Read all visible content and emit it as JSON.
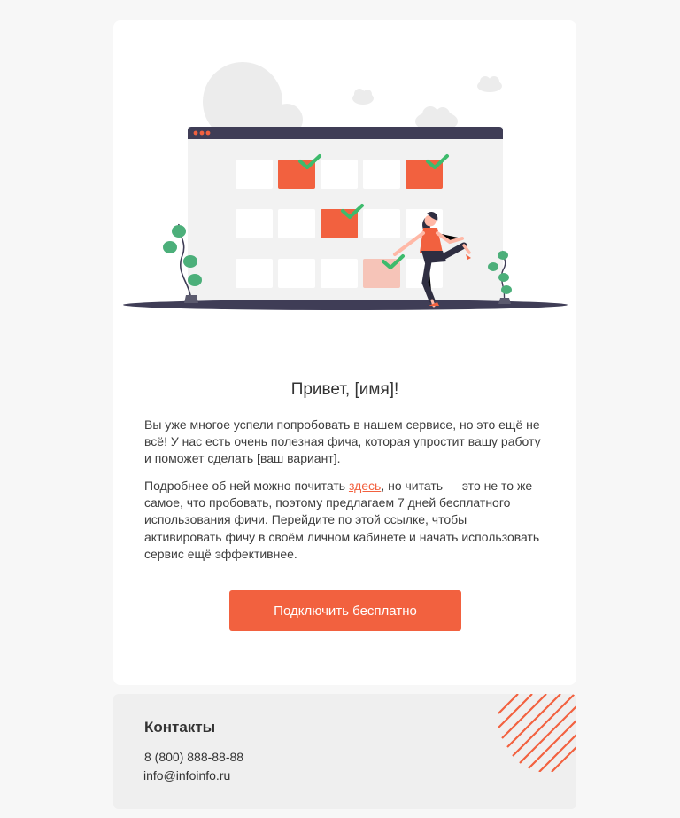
{
  "email": {
    "greeting": "Привет, [имя]!",
    "para1": "Вы уже многое успели попробовать в нашем сервисе, но это ещё не всё! У нас есть очень полезная фича, которая упростит вашу работу и поможет сделать [ваш вариант].",
    "para2_before": "Подробнее об ней можно почитать ",
    "para2_link": "здесь",
    "para2_after": ", но читать — это не то же самое, что пробовать, поэтому предлагаем 7 дней бесплатного использования фичи. Перейдите по этой ссылке, чтобы активировать фичу в своём личном кабинете и начать использовать сервис ещё эффективнее.",
    "cta_label": "Подключить бесплатно"
  },
  "footer": {
    "title": "Контакты",
    "phone": "8 (800) 888-88-88",
    "email": "info@infoinfo.ru"
  },
  "colors": {
    "accent": "#f2613f",
    "check": "#3dbb6c",
    "dark": "#3f3d56",
    "background": "#f7f7f7"
  },
  "illustration": {
    "icons": [
      "calendar-window-icon",
      "checkmark-icon",
      "woman-figure-icon",
      "plant-icon",
      "cloud-icon"
    ]
  }
}
